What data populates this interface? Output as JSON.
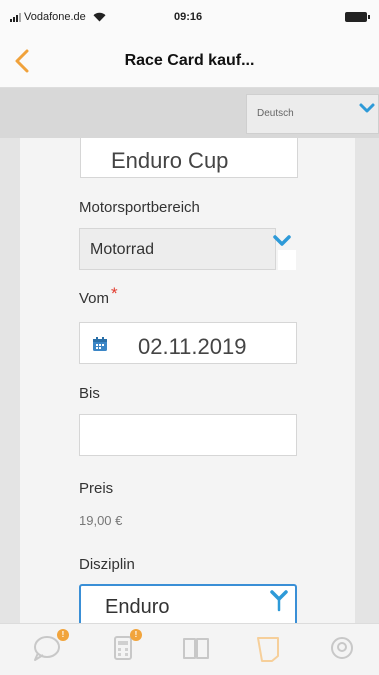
{
  "status_bar": {
    "carrier": "Vodafone.de",
    "time": "09:16"
  },
  "nav": {
    "title": "Race Card kauf..."
  },
  "language": {
    "selected": "Deutsch"
  },
  "form": {
    "event_value": "Enduro Cup",
    "motorsport": {
      "label": "Motorsportbereich",
      "value": "Motorrad"
    },
    "vom": {
      "label": "Vom",
      "required_mark": "*",
      "value": "02.11.2019"
    },
    "bis": {
      "label": "Bis",
      "value": ""
    },
    "preis": {
      "label": "Preis",
      "value": "19,00 €"
    },
    "disziplin": {
      "label": "Disziplin",
      "value": "Enduro"
    }
  },
  "tabs": [
    {
      "icon": "chat-icon",
      "label": "",
      "badge": "!"
    },
    {
      "icon": "calculator-icon",
      "label": "",
      "badge": "!"
    },
    {
      "icon": "book-icon",
      "label": ""
    },
    {
      "icon": "card-icon",
      "label": ""
    },
    {
      "icon": "speech-icon",
      "label": ""
    }
  ],
  "colors": {
    "accent": "#f0a23b",
    "chevron": "#2e9ad8",
    "required": "#e23b2e",
    "active_border": "#3a8fd6"
  }
}
